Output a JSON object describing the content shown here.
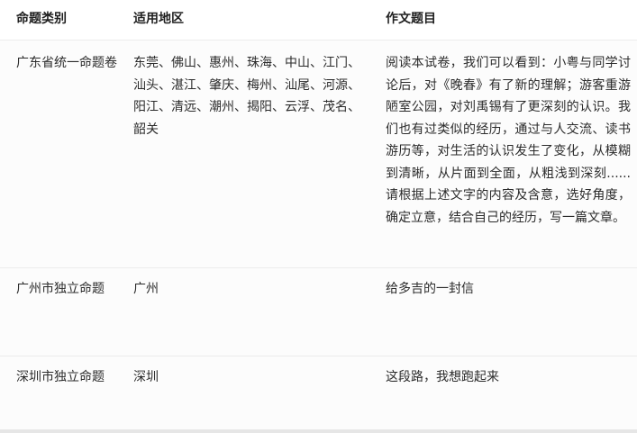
{
  "table": {
    "headers": [
      "命题类别",
      "适用地区",
      "作文题目"
    ],
    "rows": [
      {
        "category": "广东省统一命题卷",
        "region": "东莞、佛山、惠州、珠海、中山、江门、汕头、湛江、肇庆、梅州、汕尾、河源、阳江、清远、潮州、揭阳、云浮、茂名、韶关",
        "prompt": "阅读本试卷，我们可以看到：小粤与同学讨论后，对《晚春》有了新的理解；游客重游陋室公园，对刘禹锡有了更深刻的认识。我们也有过类似的经历，通过与人交流、读书游历等，对生活的认识发生了变化，从模糊到清晰，从片面到全面，从粗浅到深刻......请根据上述文字的内容及含意，选好角度，确定立意，结合自己的经历，写一篇文章。"
      },
      {
        "category": "广州市独立命题",
        "region": "广州",
        "prompt": "给多吉的一封信"
      },
      {
        "category": "深圳市独立命题",
        "region": "深圳",
        "prompt": "这段路，我想跑起来"
      }
    ]
  }
}
